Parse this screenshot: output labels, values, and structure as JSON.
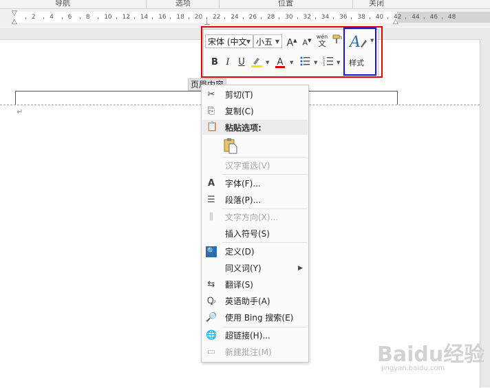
{
  "ribbon_groups": [
    "导航",
    "选项",
    "位置",
    "关闭"
  ],
  "ruler": {
    "ticks": [
      "2",
      "4",
      "6",
      "8",
      "10",
      "12",
      "14",
      "16",
      "18",
      "20",
      "22",
      "24",
      "26",
      "28",
      "30",
      "32",
      "34",
      "36",
      "38",
      "40",
      "42",
      "44",
      "46",
      "48"
    ]
  },
  "document": {
    "header_tag": "页眉内容",
    "paragraph_mark": "↵"
  },
  "mini_toolbar": {
    "font_name": "宋体 (中文",
    "font_size": "小五",
    "grow_font": "A",
    "shrink_font": "A",
    "phonetic": "wén",
    "bold": "B",
    "italic": "I",
    "underline": "U",
    "font_color_letter": "A",
    "styles_label": "样式",
    "highlight_color": "#f5e600",
    "font_color": "#e00000",
    "annotation_red": "#e00000",
    "annotation_blue": "#1515d0"
  },
  "context_menu": {
    "cut": "剪切(T)",
    "copy": "复制(C)",
    "paste_options": "粘贴选项:",
    "reconvert": "汉字重选(V)",
    "font": "字体(F)...",
    "paragraph": "段落(P)...",
    "text_direction": "文字方向(X)...",
    "insert_symbol": "插入符号(S)",
    "define": "定义(D)",
    "synonyms": "同义词(Y)",
    "translate": "翻译(S)",
    "english_assistant": "英语助手(A)",
    "bing_search": "使用 Bing 搜索(E)",
    "hyperlink": "超链接(H)...",
    "new_comment": "新建批注(M)"
  },
  "watermark": {
    "main": "Baidu经验",
    "sub": "jingyan.baidu.com"
  }
}
